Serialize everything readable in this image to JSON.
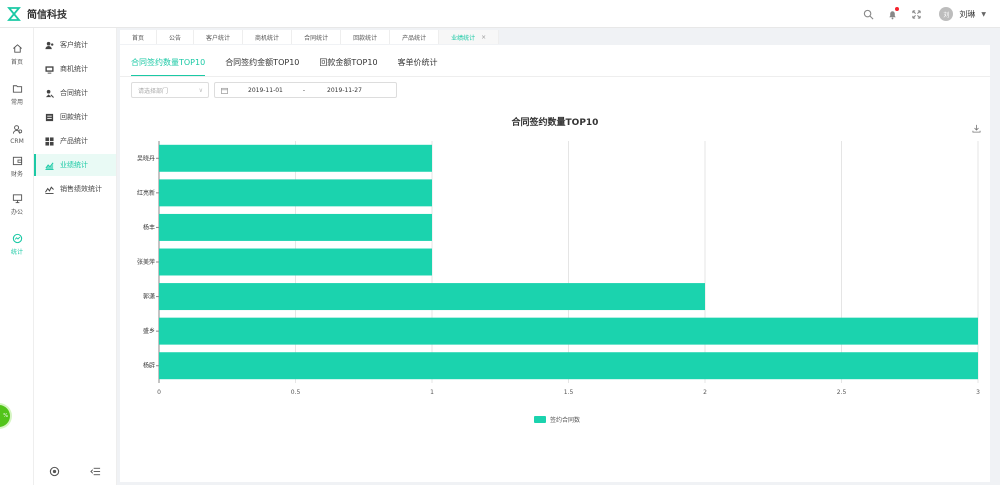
{
  "app": {
    "title": "简信科技"
  },
  "header": {
    "user_name": "刘琳",
    "avatar_text": "刘"
  },
  "rail": [
    {
      "label": "首页",
      "icon": "home-icon"
    },
    {
      "label": "常用",
      "icon": "folder-icon"
    },
    {
      "label": "CRM",
      "icon": "users-icon"
    },
    {
      "label": "财务",
      "icon": "wallet-icon"
    },
    {
      "label": "办公",
      "icon": "monitor-icon"
    },
    {
      "label": "统计",
      "icon": "chart-icon"
    }
  ],
  "submenu": [
    {
      "label": "客户统计",
      "icon": "customer-icon"
    },
    {
      "label": "商机统计",
      "icon": "opportunity-icon"
    },
    {
      "label": "合同统计",
      "icon": "contract-icon"
    },
    {
      "label": "回款统计",
      "icon": "payment-icon"
    },
    {
      "label": "产品统计",
      "icon": "product-icon"
    },
    {
      "label": "业绩统计",
      "icon": "performance-icon"
    },
    {
      "label": "销售绩效统计",
      "icon": "sales-kpi-icon"
    }
  ],
  "tabs": [
    {
      "label": "首页"
    },
    {
      "label": "公告"
    },
    {
      "label": "客户统计"
    },
    {
      "label": "商机统计"
    },
    {
      "label": "合同统计"
    },
    {
      "label": "回款统计"
    },
    {
      "label": "产品统计"
    },
    {
      "label": "业绩统计",
      "close": "×"
    }
  ],
  "subtabs": [
    {
      "label": "合同签约数量TOP10"
    },
    {
      "label": "合同签约金额TOP10"
    },
    {
      "label": "回款金额TOP10"
    },
    {
      "label": "客单价统计"
    }
  ],
  "filters": {
    "dept_placeholder": "请选择部门",
    "date_start": "2019-11-01",
    "date_sep": "-",
    "date_end": "2019-11-27"
  },
  "colors": {
    "accent": "#1bc9a5",
    "bar": "#1bd3ae",
    "alert": "#f5222d"
  },
  "chart_data": {
    "type": "bar",
    "orientation": "horizontal",
    "title": "合同签约数量TOP10",
    "categories": [
      "吴晓丹",
      "红亮新",
      "杨丰",
      "张美萍",
      "郭潇",
      "盛乡",
      "杨辟"
    ],
    "series": [
      {
        "name": "签约合同数",
        "values": [
          1,
          1,
          1,
          1,
          2,
          3,
          3
        ]
      }
    ],
    "xlim": [
      0,
      3
    ],
    "xticks": [
      "0",
      "0.5",
      "1",
      "1.5",
      "2",
      "2.5",
      "3"
    ],
    "grid": true,
    "legend": "bottom"
  }
}
